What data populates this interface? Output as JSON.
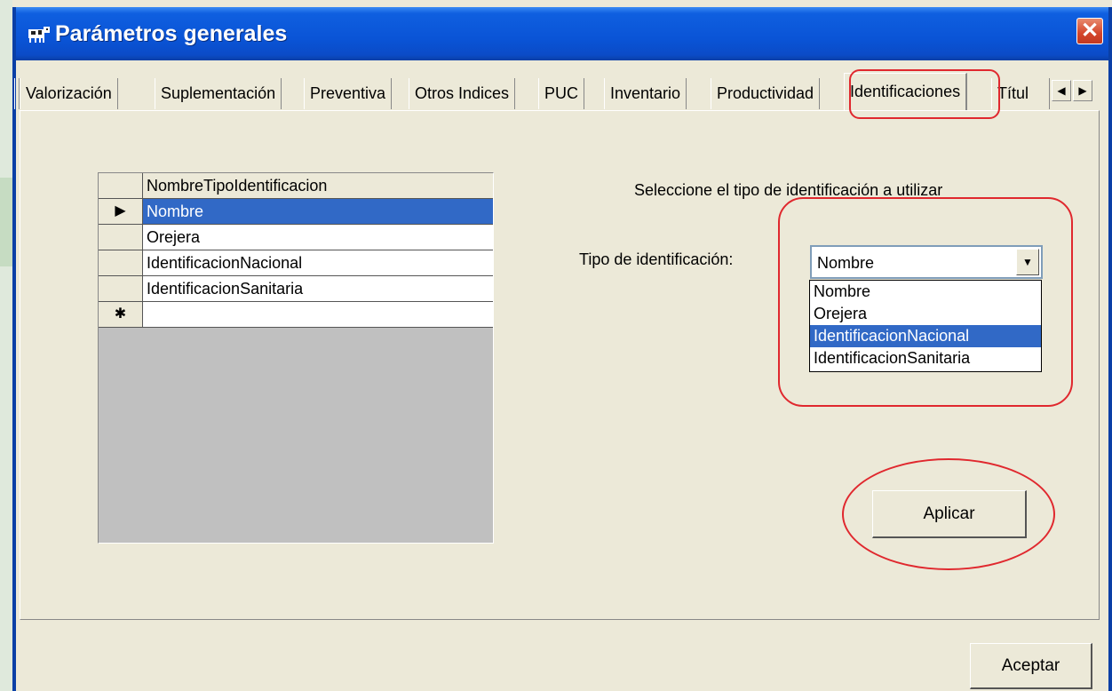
{
  "window": {
    "title": "Parámetros generales",
    "close_glyph": "✕",
    "icon": "cow-icon"
  },
  "tabs": [
    {
      "label": "Valorización"
    },
    {
      "label": "Suplementación"
    },
    {
      "label": "Preventiva"
    },
    {
      "label": "Otros Indices"
    },
    {
      "label": "PUC"
    },
    {
      "label": "Inventario"
    },
    {
      "label": "Productividad"
    },
    {
      "label": "Identificaciones",
      "active": true
    },
    {
      "label": "Títul"
    }
  ],
  "grid": {
    "column_header": "NombreTipoIdentificacion",
    "rows": [
      {
        "marker": "▶",
        "value": "Nombre",
        "selected": true
      },
      {
        "marker": "",
        "value": "Orejera"
      },
      {
        "marker": "",
        "value": "IdentificacionNacional"
      },
      {
        "marker": "",
        "value": "IdentificacionSanitaria"
      },
      {
        "marker": "✱",
        "value": ""
      }
    ]
  },
  "form": {
    "prompt": "Seleccione el tipo de identificación a utilizar",
    "field_label": "Tipo de identificación:",
    "combo_value": "Nombre",
    "options": [
      {
        "label": "Nombre"
      },
      {
        "label": "Orejera"
      },
      {
        "label": "IdentificacionNacional",
        "highlighted": true
      },
      {
        "label": "IdentificacionSanitaria"
      }
    ]
  },
  "buttons": {
    "apply": "Aplicar",
    "ok": "Aceptar"
  },
  "colors": {
    "title_bar": "#0a54d6",
    "selection": "#3169c6",
    "annotation": "#e0282e"
  }
}
